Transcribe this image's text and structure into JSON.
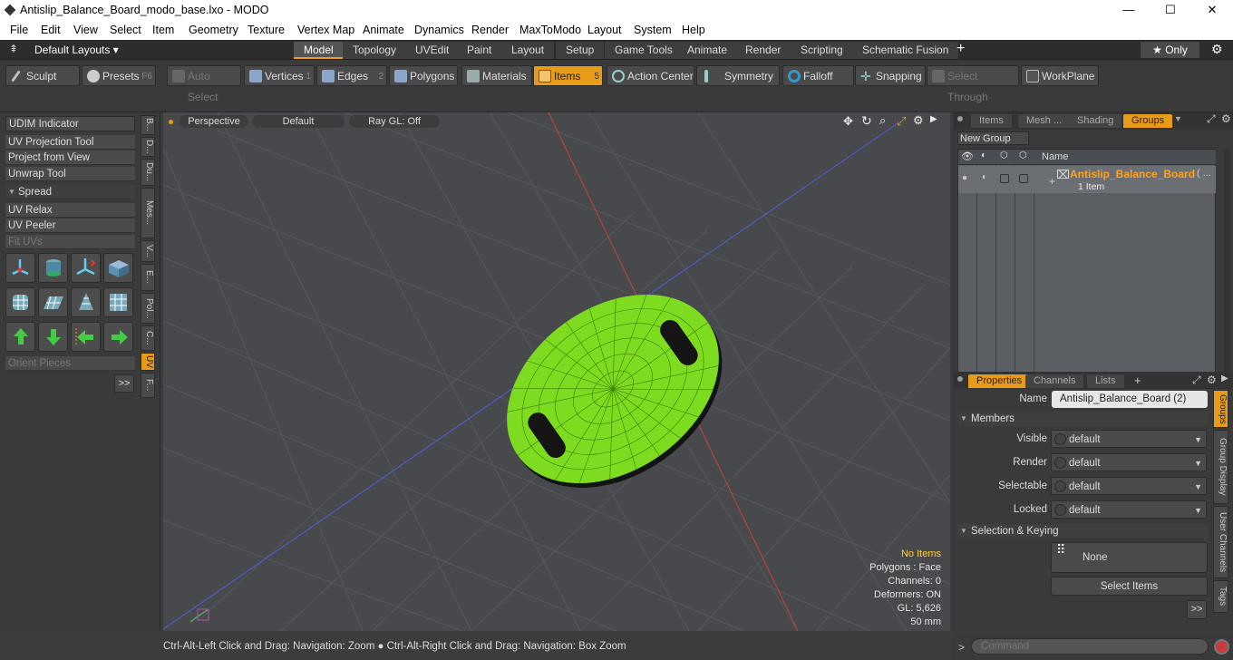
{
  "window": {
    "title": "Antislip_Balance_Board_modo_base.lxo - MODO",
    "min": "—",
    "max": "☐",
    "close": "✕"
  },
  "menu": [
    "File",
    "Edit",
    "View",
    "Select",
    "Item",
    "Geometry",
    "Texture",
    "Vertex Map",
    "Animate",
    "Dynamics",
    "Render",
    "MaxToModo",
    "Layout",
    "System",
    "Help"
  ],
  "layoutbar": {
    "layouts": "Default Layouts ▾",
    "tabs": [
      "Model",
      "Topology",
      "UVEdit",
      "Paint",
      "Layout",
      "Setup",
      "Game Tools",
      "Animate",
      "Render",
      "Scripting",
      "Schematic Fusion"
    ],
    "plus": "+",
    "only": "★ Only",
    "gear": "⚙"
  },
  "toolbar": {
    "sculpt": "Sculpt",
    "presets": "Presets",
    "presets_key": "F6",
    "auto_select": "Auto Select",
    "vertices": "Vertices",
    "vertices_n": "1",
    "edges": "Edges",
    "edges_n": "2",
    "polygons": "Polygons",
    "materials": "Materials",
    "items": "Items",
    "items_n": "5",
    "action_center": "Action Center",
    "symmetry": "Symmetry",
    "falloff": "Falloff",
    "snapping": "Snapping",
    "select_through": "Select Through",
    "workplane": "WorkPlane"
  },
  "left": {
    "udim": "UDIM Indicator",
    "uvproj": "UV Projection Tool",
    "project": "Project from View",
    "unwrap": "Unwrap Tool",
    "spread": "Spread",
    "relax": "UV Relax",
    "peeler": "UV Peeler",
    "fit": "Fit UVs",
    "orient": "Orient Pieces",
    "more": ">>",
    "vtabs": [
      "B...",
      "D...",
      "Du...",
      "Mes...",
      "V...",
      "E...",
      "Pol...",
      "C...",
      "UV",
      "F..."
    ]
  },
  "viewport": {
    "perspective": "Perspective",
    "default": "Default",
    "raygl": "Ray GL: Off",
    "stats": {
      "noitems": "No Items",
      "polygons": "Polygons : Face",
      "channels": "Channels: 0",
      "deformers": "Deformers: ON",
      "gl": "GL: 5,626",
      "mm": "50 mm"
    }
  },
  "status": "Ctrl-Alt-Left Click and Drag: Navigation: Zoom ● Ctrl-Alt-Right Click and Drag: Navigation: Box Zoom",
  "groups": {
    "tabs": [
      "Items",
      "Mesh ...",
      "Shading",
      "Groups"
    ],
    "new_group": "New Group",
    "col_name": "Name",
    "item": "Antislip_Balance_Board",
    "item_suffix": "( ...",
    "count": "1 Item"
  },
  "props": {
    "tabs": [
      "Properties",
      "Channels",
      "Lists"
    ],
    "name_label": "Name",
    "name_value": "Antislip_Balance_Board (2)",
    "members": "Members",
    "rows": [
      {
        "label": "Visible",
        "value": "default"
      },
      {
        "label": "Render",
        "value": "default"
      },
      {
        "label": "Selectable",
        "value": "default"
      },
      {
        "label": "Locked",
        "value": "default"
      }
    ],
    "sel_keying": "Selection & Keying",
    "none": "None",
    "select_items": "Select Items",
    "more": ">>",
    "vtabs": [
      "Groups",
      "Group Display",
      "User Channels",
      "Tags"
    ]
  },
  "command": {
    "placeholder": "Command",
    "prompt": ">"
  },
  "colors": {
    "accent": "#e89b18",
    "mesh": "#7ddc1f",
    "items_text": "#ffa21c"
  }
}
